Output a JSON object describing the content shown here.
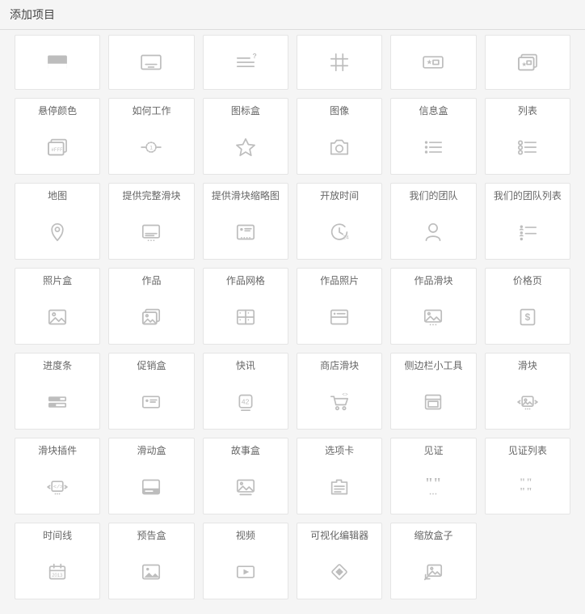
{
  "header": {
    "title": "添加项目"
  },
  "items": [
    {
      "label": "",
      "no_label": true
    },
    {
      "label": "",
      "no_label": true
    },
    {
      "label": "",
      "no_label": true
    },
    {
      "label": "",
      "no_label": true
    },
    {
      "label": "",
      "no_label": true
    },
    {
      "label": "",
      "no_label": true
    },
    {
      "label": "悬停颜色"
    },
    {
      "label": "如何工作"
    },
    {
      "label": "图标盒"
    },
    {
      "label": "图像"
    },
    {
      "label": "信息盒"
    },
    {
      "label": "列表"
    },
    {
      "label": "地图"
    },
    {
      "label": "提供完整滑块"
    },
    {
      "label": "提供滑块缩略图"
    },
    {
      "label": "开放时间"
    },
    {
      "label": "我们的团队"
    },
    {
      "label": "我们的团队列表"
    },
    {
      "label": "照片盒"
    },
    {
      "label": "作品"
    },
    {
      "label": "作品网格"
    },
    {
      "label": "作品照片"
    },
    {
      "label": "作品滑块"
    },
    {
      "label": "价格页"
    },
    {
      "label": "进度条"
    },
    {
      "label": "促销盒"
    },
    {
      "label": "快讯"
    },
    {
      "label": "商店滑块"
    },
    {
      "label": "侧边栏小工具"
    },
    {
      "label": "滑块"
    },
    {
      "label": "滑块插件"
    },
    {
      "label": "滑动盒"
    },
    {
      "label": "故事盒"
    },
    {
      "label": "选项卡"
    },
    {
      "label": "见证"
    },
    {
      "label": "见证列表"
    },
    {
      "label": "时间线"
    },
    {
      "label": "预告盒"
    },
    {
      "label": "视频"
    },
    {
      "label": "可视化编辑器"
    },
    {
      "label": "缩放盒子"
    }
  ]
}
